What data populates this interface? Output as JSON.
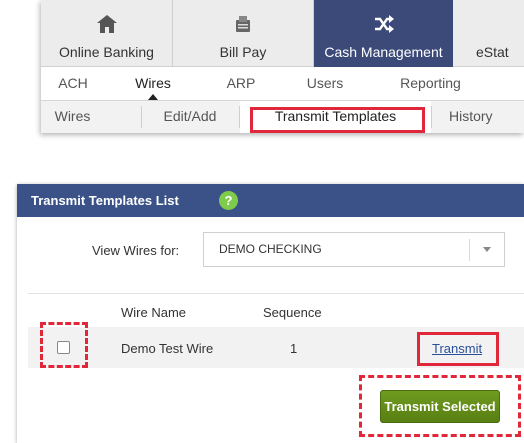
{
  "main_tabs": [
    {
      "label": "Online Banking",
      "icon": "home-icon"
    },
    {
      "label": "Bill Pay",
      "icon": "bill-icon"
    },
    {
      "label": "Cash Management",
      "icon": "shuffle-icon"
    },
    {
      "label": "eStat",
      "icon": ""
    }
  ],
  "sub_tabs": [
    "ACH",
    "Wires",
    "ARP",
    "Users",
    "Reporting"
  ],
  "third_tabs": [
    "Wires",
    "Edit/Add",
    "Transmit Templates",
    "History"
  ],
  "panel": {
    "title": "Transmit Templates List",
    "help": "?",
    "view_label": "View Wires for:",
    "view_value": "DEMO CHECKING"
  },
  "table": {
    "headers": [
      "Wire Name",
      "Sequence"
    ],
    "rows": [
      {
        "name": "Demo Test Wire",
        "sequence": "1",
        "action": "Transmit"
      }
    ]
  },
  "transmit_selected_label": "Transmit Selected",
  "colors": {
    "active_tab": "#3b4a78",
    "panel_header": "#3b5288",
    "help_icon": "#7fcb4c",
    "button": "#5e8a16",
    "highlight": "#e0283a"
  }
}
